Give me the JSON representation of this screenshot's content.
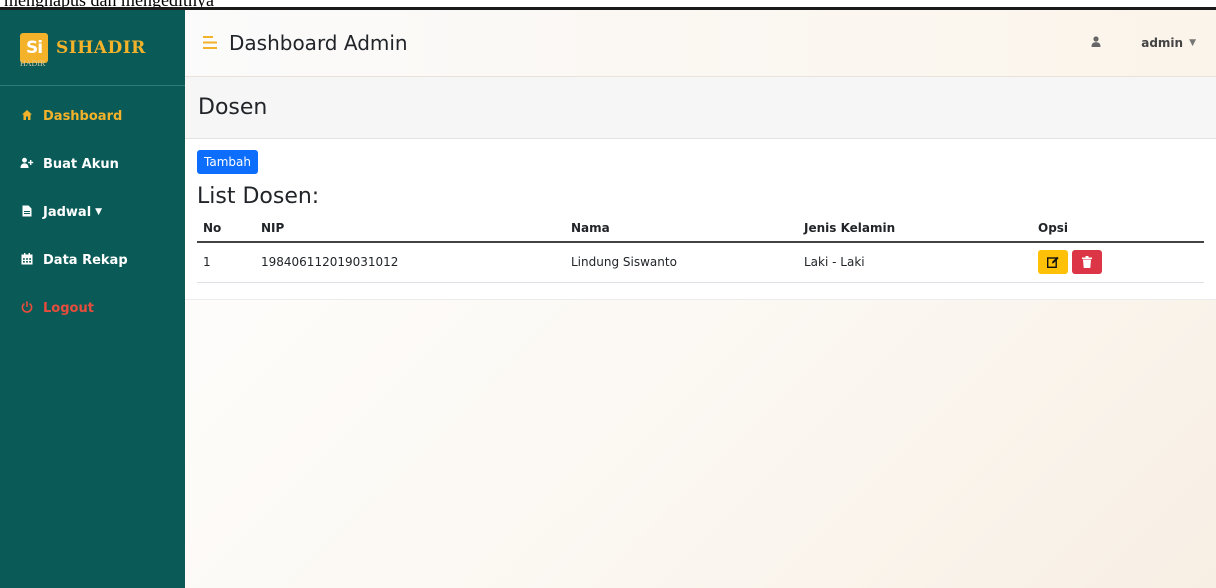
{
  "doc_strip_text": "mengnapus dan mengeditnya",
  "brand": {
    "logo_text": "Si",
    "logo_sub": "HADIR",
    "name": "SIHADIR"
  },
  "sidebar": {
    "items": [
      {
        "label": "Dashboard",
        "icon": "home-icon"
      },
      {
        "label": "Buat Akun",
        "icon": "user-plus-icon"
      },
      {
        "label": "Jadwal",
        "icon": "file-icon"
      },
      {
        "label": "Data Rekap",
        "icon": "calendar-icon"
      },
      {
        "label": "Logout",
        "icon": "power-icon"
      }
    ]
  },
  "topbar": {
    "title": "Dashboard Admin",
    "user": "admin"
  },
  "page": {
    "header": "Dosen",
    "add_button": "Tambah",
    "list_title": "List Dosen:"
  },
  "table": {
    "headers": [
      "No",
      "NIP",
      "Nama",
      "Jenis Kelamin",
      "Opsi"
    ],
    "rows": [
      {
        "no": "1",
        "nip": "198406112019031012",
        "nama": "Lindung Siswanto",
        "jenis_kelamin": "Laki - Laki"
      }
    ]
  },
  "colors": {
    "sidebar_bg": "#0a5b57",
    "accent": "#f3b22a",
    "primary": "#0d6efd",
    "warning": "#ffc107",
    "danger": "#dc3545"
  }
}
